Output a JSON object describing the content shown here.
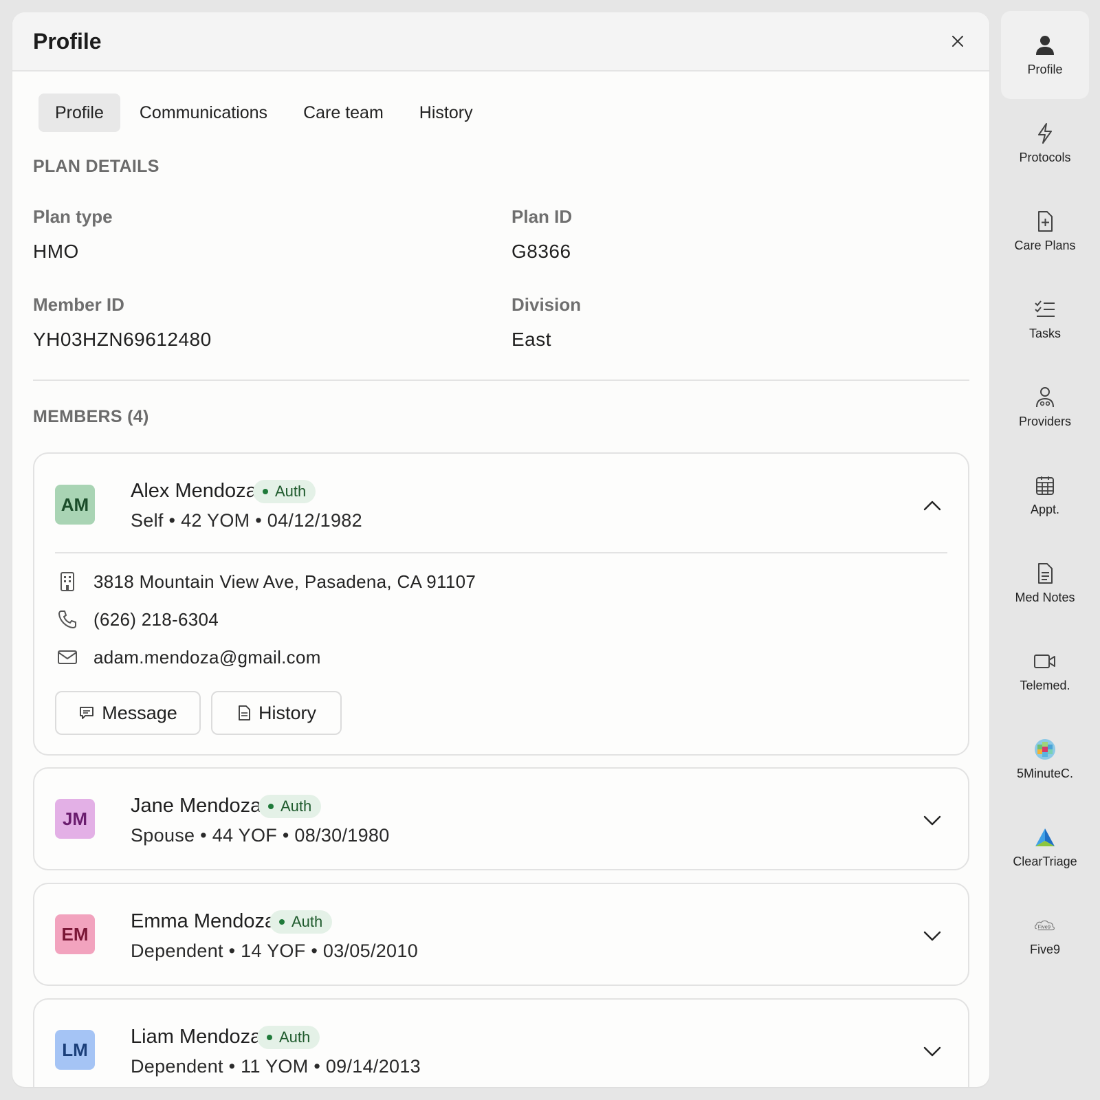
{
  "panel": {
    "title": "Profile"
  },
  "tabs": [
    {
      "label": "Profile",
      "active": true
    },
    {
      "label": "Communications"
    },
    {
      "label": "Care team"
    },
    {
      "label": "History"
    }
  ],
  "plan": {
    "section_title": "PLAN DETAILS",
    "plan_type_label": "Plan type",
    "plan_type_value": "HMO",
    "plan_id_label": "Plan ID",
    "plan_id_value": "G8366",
    "member_id_label": "Member ID",
    "member_id_value": "YH03HZN69612480",
    "division_label": "Division",
    "division_value": "East"
  },
  "members_title": "MEMBERS (4)",
  "members": [
    {
      "initials": "AM",
      "name": "Alex Mendoza",
      "badge": "Auth",
      "sub": "Self • 42 YOM • 04/12/1982",
      "expanded": true,
      "avatar_bg": "#a9d4b4",
      "avatar_fg": "#1b4d2a",
      "address": "3818 Mountain View Ave, Pasadena, CA 91107",
      "phone": "(626) 218-6304",
      "email": "adam.mendoza@gmail.com",
      "message_label": "Message",
      "history_label": "History"
    },
    {
      "initials": "JM",
      "name": "Jane Mendoza",
      "badge": "Auth",
      "sub": "Spouse • 44 YOF • 08/30/1980",
      "avatar_bg": "#e3b0e6",
      "avatar_fg": "#6a1c6e"
    },
    {
      "initials": "EM",
      "name": "Emma Mendoza",
      "badge": "Auth",
      "sub": "Dependent • 14 YOF • 03/05/2010",
      "avatar_bg": "#f2a3be",
      "avatar_fg": "#7a1636"
    },
    {
      "initials": "LM",
      "name": "Liam Mendoza",
      "badge": "Auth",
      "sub": "Dependent • 11 YOM • 09/14/2013",
      "avatar_bg": "#a5c4f5",
      "avatar_fg": "#1b3f7a"
    }
  ],
  "rail": [
    {
      "label": "Profile",
      "icon": "person-icon"
    },
    {
      "label": "Protocols",
      "icon": "lightning-icon"
    },
    {
      "label": "Care Plans",
      "icon": "file-plus-icon"
    },
    {
      "label": "Tasks",
      "icon": "checklist-icon"
    },
    {
      "label": "Providers",
      "icon": "providers-icon"
    },
    {
      "label": "Appt.",
      "icon": "calendar-icon"
    },
    {
      "label": "Med Notes",
      "icon": "document-icon"
    },
    {
      "label": "Telemed.",
      "icon": "video-icon"
    },
    {
      "label": "5MinuteC.",
      "icon": "5minute-logo-icon"
    },
    {
      "label": "ClearTriage",
      "icon": "cleartriage-logo-icon"
    },
    {
      "label": "Five9",
      "icon": "five9-logo-icon",
      "logo_text": "Five9"
    }
  ]
}
